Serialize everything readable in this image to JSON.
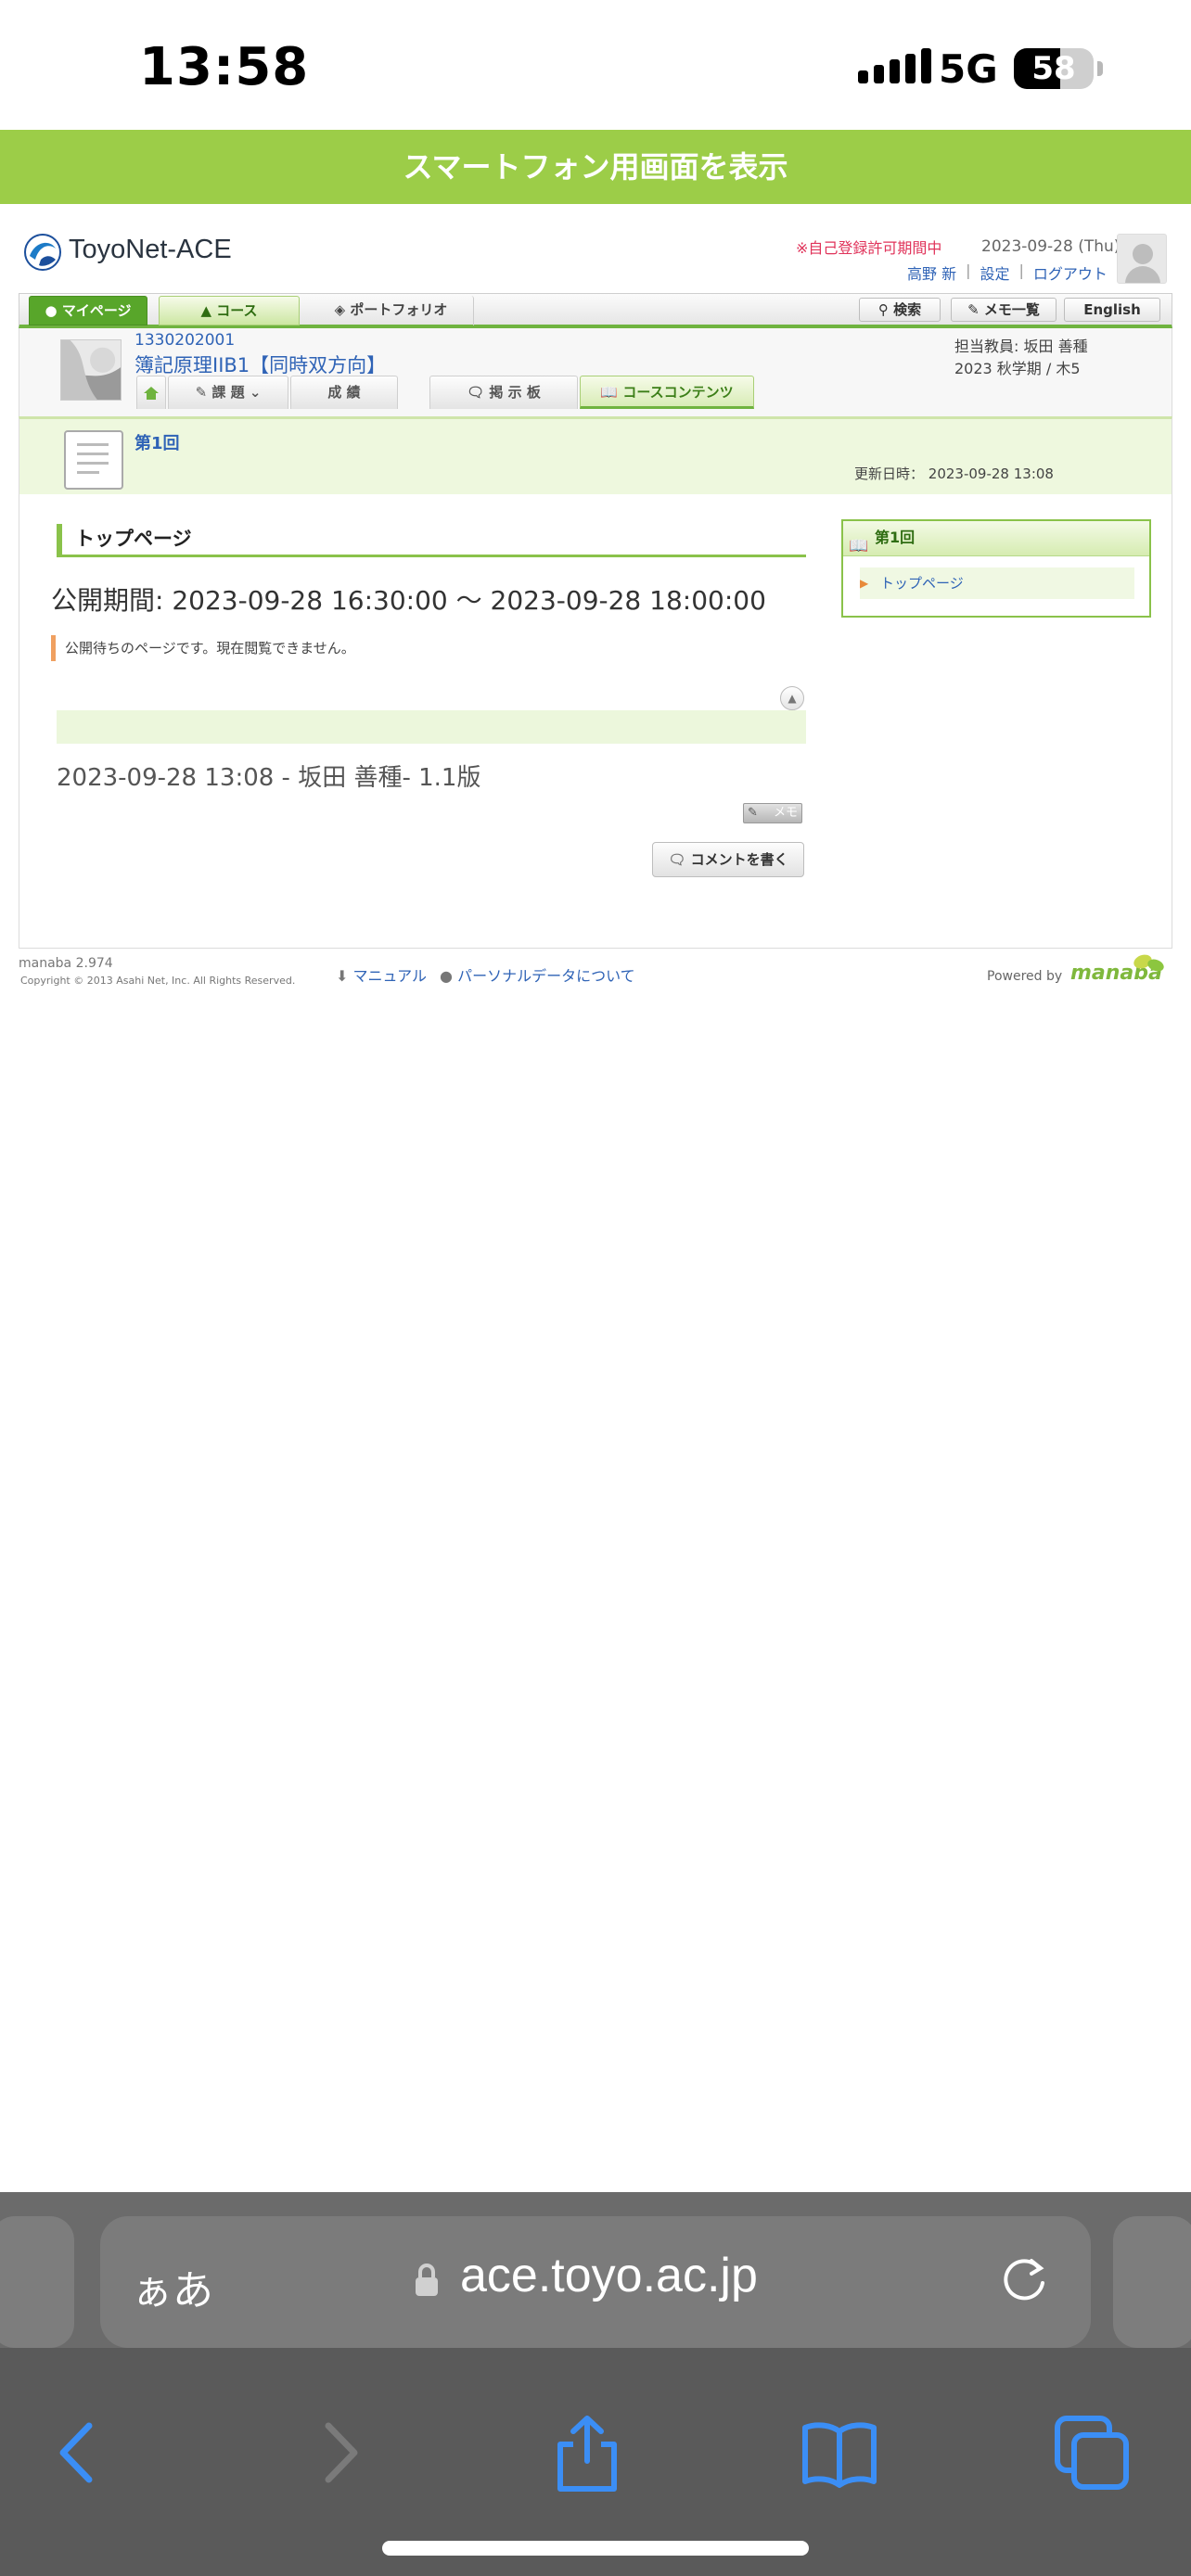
{
  "status_bar": {
    "time": "13:58",
    "network": "5G",
    "battery": "58",
    "battery_level": 0.58
  },
  "banner": {
    "label": "スマートフォン用画面を表示"
  },
  "header": {
    "logo_text": "ToyoNet-ACE",
    "self_registration": "※自己登録許可期間中",
    "date": "2023-09-28 (Thu)",
    "user": "高野 新",
    "settings": "設定",
    "logout": "ログアウト",
    "separator": "|"
  },
  "nav": {
    "mypage": "マイページ",
    "course": "コース",
    "portfolio": "ポートフォリオ",
    "search": "検索",
    "memo_list": "メモ一覧",
    "english": "English"
  },
  "course": {
    "code": "1330202001",
    "name": "簿記原理IIB1【同時双方向】",
    "teacher": "担当教員: 坂田 善種",
    "term": "2023 秋学期 / 木5",
    "tabs": {
      "task": "課 題",
      "grade": "成 績",
      "board": "掲 示 板",
      "contents": "コースコンテンツ"
    }
  },
  "page": {
    "title": "第1回",
    "updated_label": "更新日時：",
    "updated_value": "2023-09-28 13:08"
  },
  "content": {
    "section_title": "トップページ",
    "period": "公開期間: 2023-09-28 16:30:00 〜 2023-09-28 18:00:00",
    "notice": "公開待ちのページです。現在閲覧できません。",
    "version_line": "2023-09-28 13:08 - 坂田 善種- 1.1版",
    "memo_button": "メモ",
    "comment_button": "コメントを書く"
  },
  "sidebar": {
    "title": "第1回",
    "items": [
      {
        "label": "トップページ"
      }
    ]
  },
  "footer": {
    "version": "manaba 2.974",
    "copyright": "Copyright © 2013 Asahi Net, Inc. All Rights Reserved.",
    "manual": "マニュアル",
    "personal_data": "パーソナルデータについて",
    "powered_by": "Powered by",
    "brand": "manaba"
  },
  "browser": {
    "aa": "ぁあ",
    "url": "ace.toyo.ac.jp"
  },
  "colors": {
    "banner_green": "#9ccd48",
    "link_blue": "#2f63b6",
    "accent_green": "#8ac24a",
    "alert_red": "#e0335a"
  }
}
